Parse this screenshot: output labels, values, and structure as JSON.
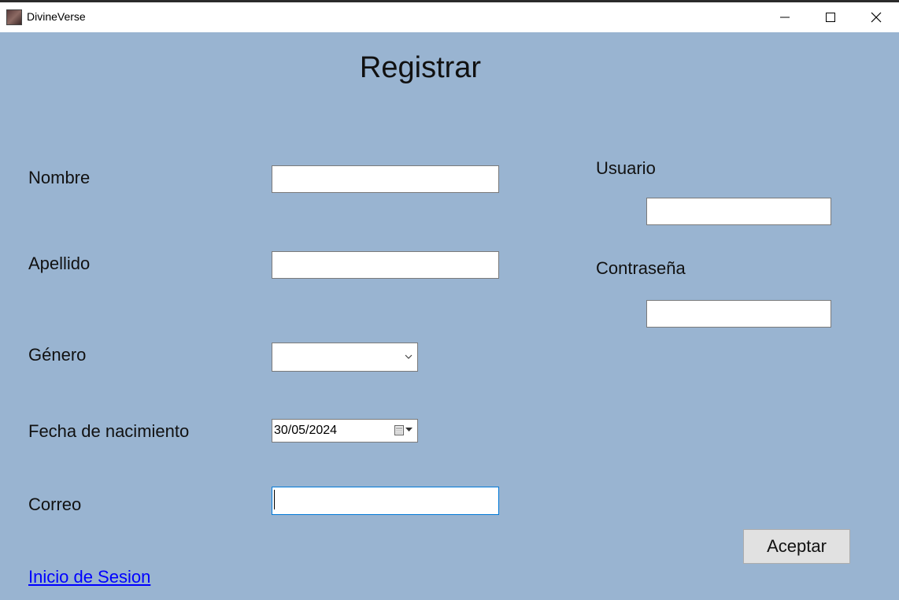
{
  "window": {
    "title": "DivineVerse"
  },
  "form": {
    "heading": "Registrar",
    "labels": {
      "nombre": "Nombre",
      "apellido": "Apellido",
      "genero": "Género",
      "fecha": "Fecha de nacimiento",
      "correo": "Correo",
      "usuario": "Usuario",
      "contrasena": "Contraseña"
    },
    "values": {
      "nombre": "",
      "apellido": "",
      "genero": "",
      "fecha": "30/05/2024",
      "correo": "",
      "usuario": "",
      "contrasena": ""
    },
    "accept_label": "Aceptar",
    "login_link": "Inicio de Sesion"
  },
  "icons": {
    "app": "app-icon",
    "minimize": "minimize-icon",
    "maximize": "maximize-icon",
    "close": "close-icon",
    "dropdown": "chevron-down-icon",
    "calendar": "calendar-icon"
  },
  "colors": {
    "background": "#99b4d1",
    "titlebar": "#ffffff",
    "link": "#0000ff",
    "focus_border": "#0078d7",
    "button": "#e1e1e1"
  }
}
